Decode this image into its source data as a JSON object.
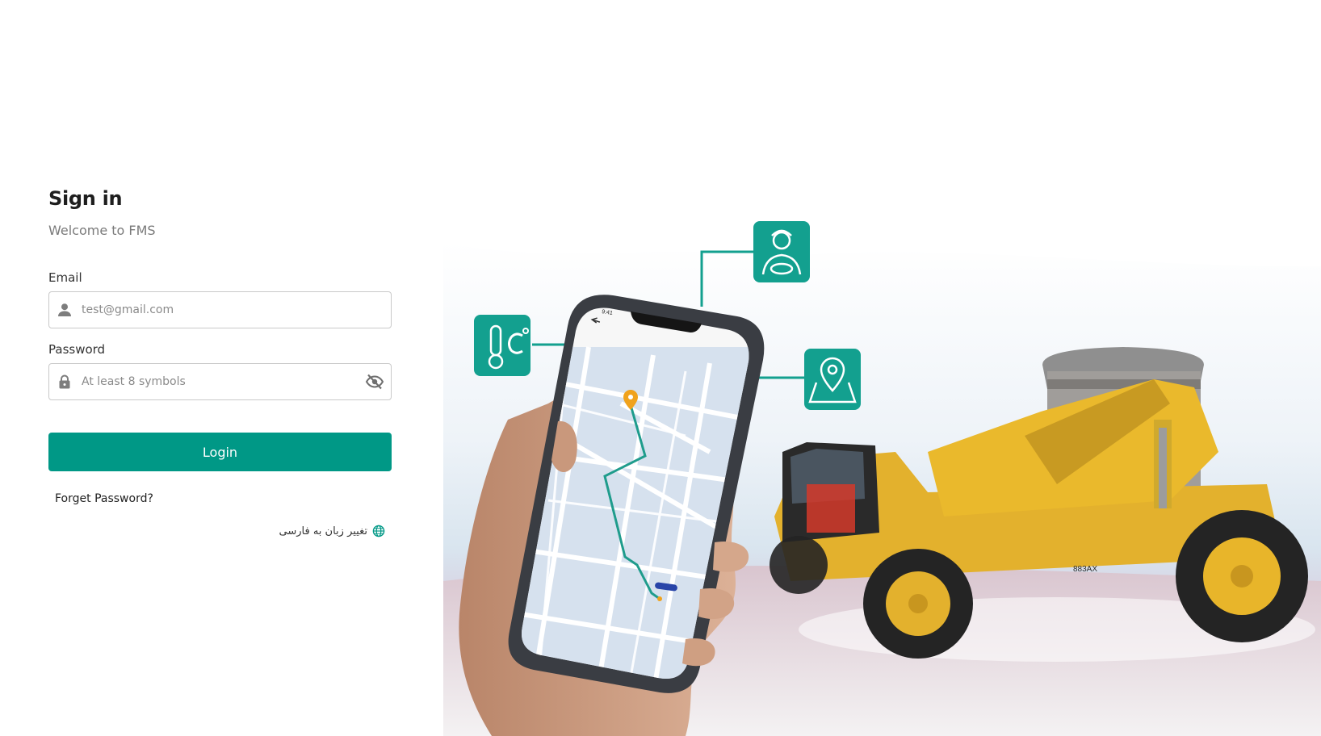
{
  "form": {
    "title": "Sign in",
    "subtitle": "Welcome to FMS",
    "email": {
      "label": "Email",
      "placeholder": "test@gmail.com",
      "value": ""
    },
    "password": {
      "label": "Password",
      "placeholder": "At least 8 symbols",
      "value": ""
    },
    "login_label": "Login",
    "forget_label": "Forget Password?",
    "language_label": "تغییر زبان به فارسی"
  },
  "hero": {
    "phone_time": "9:41",
    "icons": [
      "thermometer-celsius-icon",
      "driver-icon",
      "map-location-icon"
    ],
    "truck_label": "883AX"
  },
  "colors": {
    "primary": "#009886",
    "accent_pin": "#f0a21c",
    "truck_yellow": "#e9b527"
  }
}
